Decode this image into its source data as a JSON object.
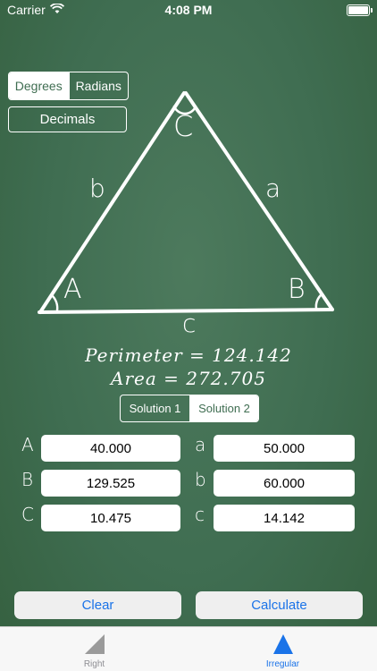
{
  "status_bar": {
    "carrier": "Carrier",
    "time": "4:08 PM"
  },
  "units": {
    "options": [
      "Degrees",
      "Radians"
    ],
    "selected": "Degrees"
  },
  "decimals_label": "Decimals",
  "triangle": {
    "vertex_A": "A",
    "vertex_B": "B",
    "vertex_C": "C",
    "side_a": "a",
    "side_b": "b",
    "side_c": "c"
  },
  "results": {
    "perimeter": "Perimeter = 124.142",
    "area": "Area = 272.705"
  },
  "solution": {
    "options": [
      "Solution 1",
      "Solution 2"
    ],
    "selected": "Solution 2"
  },
  "fields": {
    "A": {
      "label": "A",
      "value": "40.000"
    },
    "B": {
      "label": "B",
      "value": "129.525"
    },
    "C": {
      "label": "C",
      "value": "10.475"
    },
    "a": {
      "label": "a",
      "value": "50.000"
    },
    "b": {
      "label": "b",
      "value": "60.000"
    },
    "c": {
      "label": "c",
      "value": "14.142"
    }
  },
  "buttons": {
    "clear": "Clear",
    "calculate": "Calculate"
  },
  "tabs": [
    {
      "label": "Right",
      "active": false
    },
    {
      "label": "Irregular",
      "active": true
    }
  ],
  "colors": {
    "chalkboard": "#3f6d51",
    "accent": "#1a73e8",
    "tab_inactive": "#8e8e93"
  }
}
